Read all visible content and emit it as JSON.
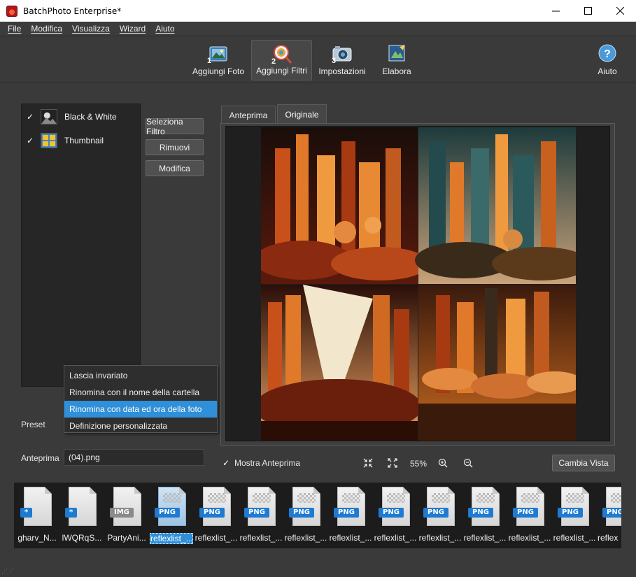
{
  "window": {
    "title": "BatchPhoto Enterprise*"
  },
  "menu": [
    "File",
    "Modifica",
    "Visualizza",
    "Wizard",
    "Aiuto"
  ],
  "toolbar": {
    "add_photos": {
      "label": "Aggiungi Foto",
      "step": "1"
    },
    "add_filters": {
      "label": "Aggiungi Filtri",
      "step": "2"
    },
    "settings": {
      "label": "Impostazioni",
      "step": "3"
    },
    "process": {
      "label": "Elabora"
    },
    "help": {
      "label": "Aiuto"
    }
  },
  "filters": [
    {
      "label": "Black & White",
      "checked": true
    },
    {
      "label": "Thumbnail",
      "checked": true
    }
  ],
  "buttons": {
    "select_filter": "Seleziona Filtro",
    "remove": "Rimuovi",
    "edit": "Modifica",
    "change_view": "Cambia Vista"
  },
  "rename_dropdown": {
    "options": [
      "Lascia invariato",
      "Rinomina con il nome della cartella",
      "Rinomina con data ed ora della foto",
      "Definizione personalizzata"
    ],
    "selected_index": 2
  },
  "labels": {
    "preset": "Preset",
    "preview": "Anteprima"
  },
  "preview_value": "(04).png",
  "tabs": {
    "preview": "Anteprima",
    "original": "Originale",
    "active": "original"
  },
  "show_preview": {
    "label": "Mostra Anteprima",
    "checked": true
  },
  "zoom": "55%",
  "thumbnails": [
    {
      "label": "gharv_N...",
      "type": "*"
    },
    {
      "label": "lWQRqS...",
      "type": "*"
    },
    {
      "label": "PartyAni...",
      "type": "IMG"
    },
    {
      "label": "reflexlist_...",
      "type": "PNG",
      "selected": true
    },
    {
      "label": "reflexlist_...",
      "type": "PNG"
    },
    {
      "label": "reflexlist_...",
      "type": "PNG"
    },
    {
      "label": "reflexlist_...",
      "type": "PNG"
    },
    {
      "label": "reflexlist_...",
      "type": "PNG"
    },
    {
      "label": "reflexlist_...",
      "type": "PNG"
    },
    {
      "label": "reflexlist_...",
      "type": "PNG"
    },
    {
      "label": "reflexlist_...",
      "type": "PNG"
    },
    {
      "label": "reflexlist_...",
      "type": "PNG"
    },
    {
      "label": "reflexlist_...",
      "type": "PNG"
    },
    {
      "label": "reflex",
      "type": "PNG"
    }
  ],
  "colors": {
    "accent": "#2f8fd8",
    "badge": "#1f7bd1",
    "background": "#3a3a3a"
  }
}
